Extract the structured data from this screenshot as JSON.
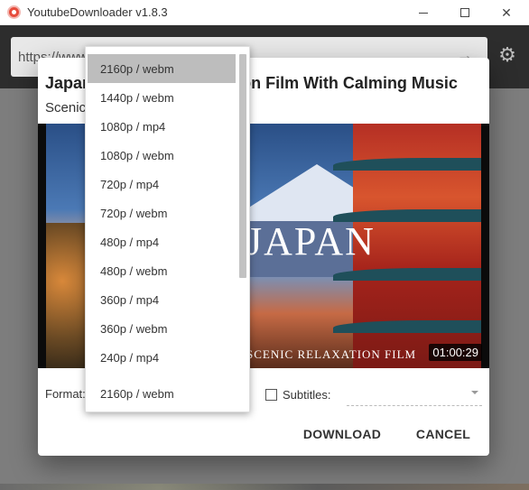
{
  "window": {
    "title": "YoutubeDownloader v1.8.3"
  },
  "toolbar": {
    "url_value": "https://www.youtube.com/watch?v="
  },
  "dialog": {
    "title": "Japan 4K Scenic Relaxation Film With Calming Music",
    "subtitle": "Scenic Relaxation",
    "thumbnail": {
      "overlay_title": "JAPAN",
      "overlay_subtitle": "SCENIC RELAXATION FILM",
      "duration": "01:00:29"
    },
    "format_label": "Format:",
    "subtitles_label": "Subtitles:",
    "download_label": "DOWNLOAD",
    "cancel_label": "CANCEL"
  },
  "dropdown": {
    "options": [
      "2160p / webm",
      "1440p / webm",
      "1080p / mp4",
      "1080p / webm",
      "720p / mp4",
      "720p / webm",
      "480p / mp4",
      "480p / webm",
      "360p / mp4",
      "360p / webm",
      "240p / mp4"
    ],
    "selected_index": 0,
    "current_value": "2160p / webm"
  }
}
